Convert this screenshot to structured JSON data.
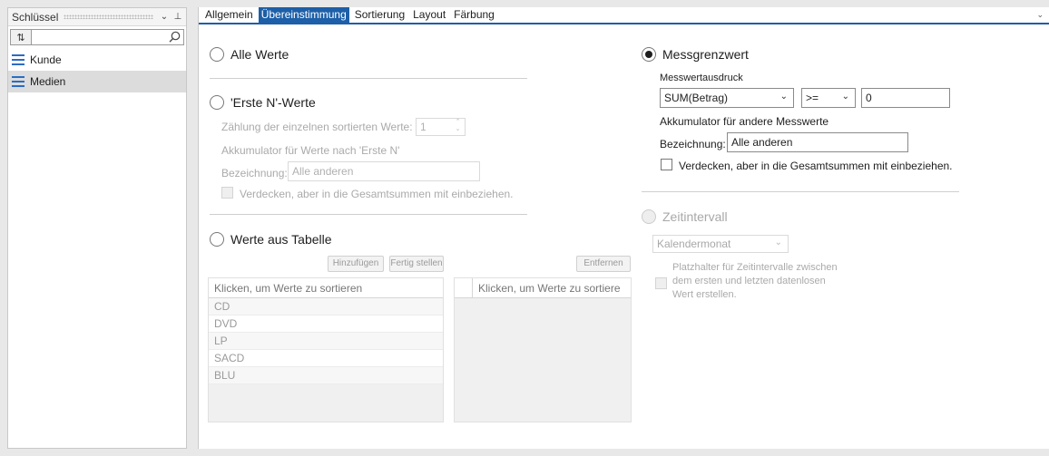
{
  "key_panel": {
    "title": "Schlüssel",
    "pin_glyph": "⊥",
    "dropdown_glyph": "⌄",
    "sort_button_glyph": "⇅",
    "search_placeholder": "",
    "items": [
      {
        "label": "Kunde",
        "selected": false
      },
      {
        "label": "Medien",
        "selected": true
      }
    ],
    "accent_color": "#2b6cc4"
  },
  "tabs": {
    "items": [
      "Allgemein",
      "Übereinstimmung",
      "Sortierung",
      "Layout",
      "Färbung"
    ],
    "active": "Übereinstimmung",
    "accent_color": "#1d5fa8",
    "overflow_glyph": "⌄"
  },
  "left_col": {
    "all_values": {
      "label": "Alle Werte",
      "checked": false
    },
    "first_n": {
      "label": "'Erste N'-Werte",
      "checked": false,
      "count_label": "Zählung der einzelnen sortierten Werte:",
      "count_value": "1",
      "accumulator_label": "Akkumulator für Werte nach 'Erste N'",
      "name_label": "Bezeichnung:",
      "name_value": "Alle anderen",
      "hide_label": "Verdecken, aber in die Gesamtsummen mit einbeziehen."
    },
    "from_table": {
      "label": "Werte aus Tabelle",
      "checked": false,
      "add_button": "Hinzufügen",
      "finish_button": "Fertig stellen",
      "remove_button": "Entfernen",
      "left_list": {
        "header": "Klicken, um Werte zu sortieren",
        "rows": [
          "CD",
          "DVD",
          "LP",
          "SACD",
          "BLU"
        ]
      },
      "right_list": {
        "header": "Klicken, um Werte zu sortiere",
        "rows": []
      }
    }
  },
  "right_col": {
    "measure_limit": {
      "label": "Messgrenzwert",
      "checked": true,
      "expression_label": "Messwertausdruck",
      "expression_value": "SUM(Betrag)",
      "operator_value": ">=",
      "threshold_value": "0",
      "accumulator_label": "Akkumulator für andere Messwerte",
      "name_label": "Bezeichnung:",
      "name_value": "Alle anderen",
      "hide_label": "Verdecken, aber in die Gesamtsummen mit einbeziehen."
    },
    "time_interval": {
      "label": "Zeitintervall",
      "checked": false,
      "interval_value": "Kalendermonat",
      "placeholder_line1": "Platzhalter für Zeitintervalle zwischen",
      "placeholder_line2": "dem ersten und letzten datenlosen",
      "placeholder_line3": "Wert erstellen."
    }
  }
}
